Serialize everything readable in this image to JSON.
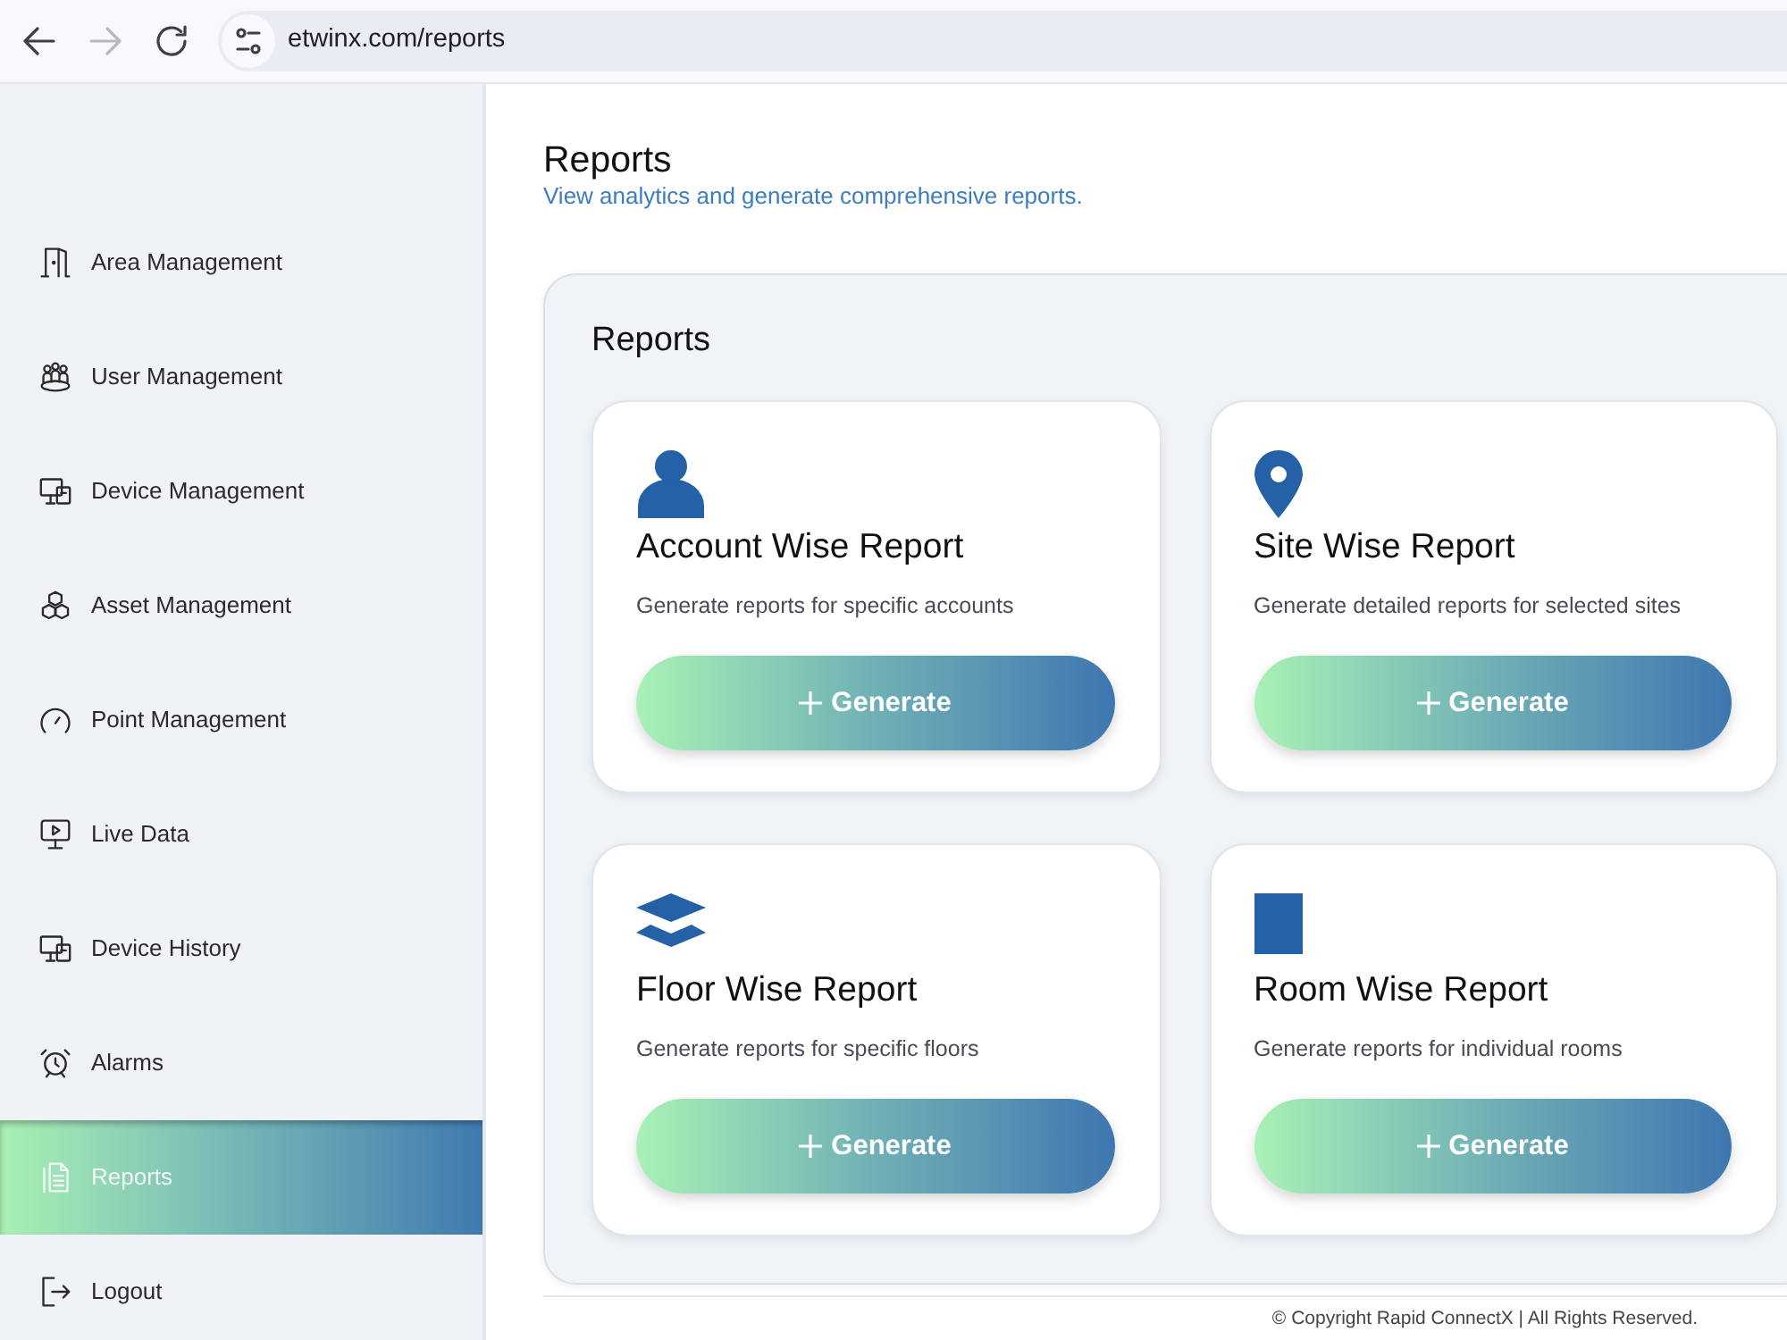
{
  "browser": {
    "nav": [
      {
        "kind": "back",
        "disabled": false
      },
      {
        "kind": "forward",
        "disabled": true
      },
      {
        "kind": "reload",
        "disabled": false
      }
    ],
    "url": "etwinx.com/reports"
  },
  "sidebar": {
    "items": [
      {
        "label": "Area Management",
        "selected": false
      },
      {
        "label": "User Management",
        "selected": false
      },
      {
        "label": "Device Management",
        "selected": false
      },
      {
        "label": "Asset Management",
        "selected": false
      },
      {
        "label": "Point Management",
        "selected": false
      },
      {
        "label": "Live Data",
        "selected": false
      },
      {
        "label": "Device History",
        "selected": false
      },
      {
        "label": "Alarms",
        "selected": false
      },
      {
        "label": "Reports",
        "selected": true
      },
      {
        "label": "Logout",
        "selected": false
      }
    ]
  },
  "page": {
    "title": "Reports",
    "subtitle": "View analytics and generate comprehensive reports."
  },
  "panel": {
    "title": "Reports",
    "cards": [
      {
        "title": "Account Wise Report",
        "description": "Generate reports for specific accounts",
        "button": "Generate"
      },
      {
        "title": "Site Wise Report",
        "description": "Generate detailed reports for selected sites",
        "button": "Generate"
      },
      {
        "title": "Floor Wise Report",
        "description": "Generate reports for specific floors",
        "button": "Generate"
      },
      {
        "title": "Room Wise Report",
        "description": "Generate reports for individual rooms",
        "button": "Generate"
      }
    ]
  },
  "footer": {
    "text": "© Copyright Rapid ConnectX | All Rights Reserved."
  }
}
